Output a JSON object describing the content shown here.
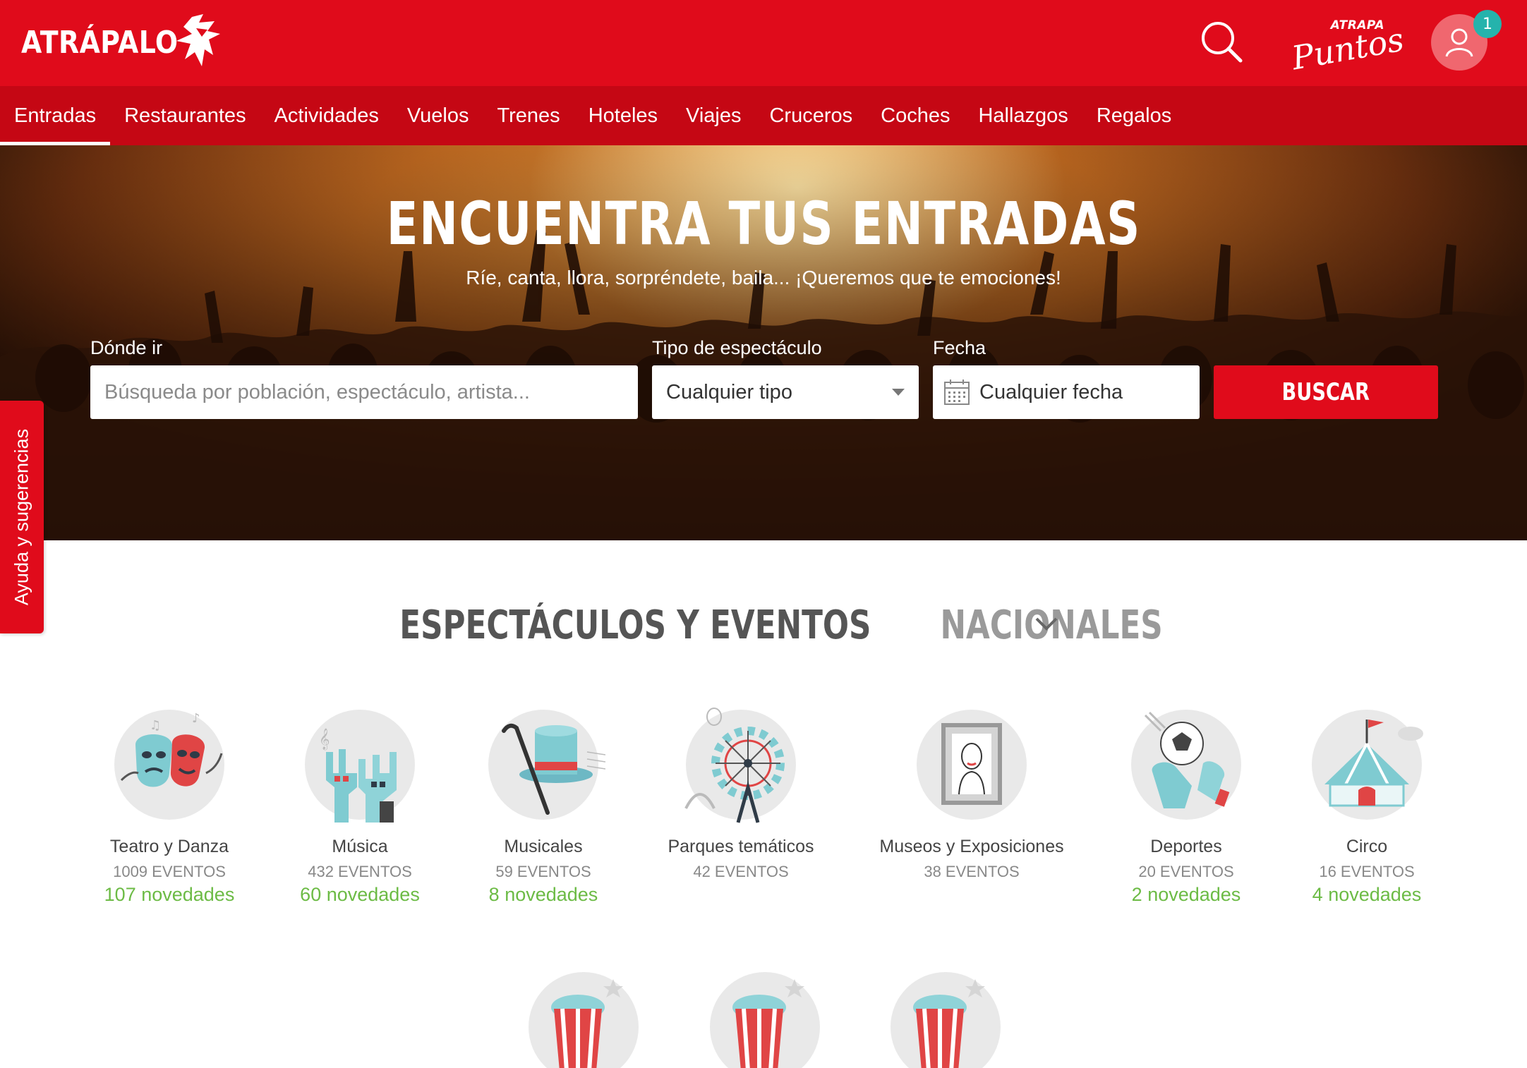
{
  "header": {
    "logo": "ATRÁPALO",
    "puntos_small": "ATRAPA",
    "puntos_big": "Puntos",
    "user_badge": "1"
  },
  "nav": {
    "items": [
      "Entradas",
      "Restaurantes",
      "Actividades",
      "Vuelos",
      "Trenes",
      "Hoteles",
      "Viajes",
      "Cruceros",
      "Coches",
      "Hallazgos",
      "Regalos"
    ],
    "active": "Entradas"
  },
  "hero": {
    "title": "ENCUENTRA TUS ENTRADAS",
    "subtitle": "Ríe, canta, llora, sorpréndete, baila... ¡Queremos que te emociones!"
  },
  "search": {
    "where_label": "Dónde ir",
    "where_placeholder": "Búsqueda por población, espectáculo, artista...",
    "type_label": "Tipo de espectáculo",
    "type_value": "Cualquier tipo",
    "date_label": "Fecha",
    "date_value": "Cualquier fecha",
    "button": "BUSCAR"
  },
  "side_tab": "Ayuda y sugerencias",
  "section": {
    "title_part1": "ESPECTÁCULOS Y EVENTOS",
    "title_part2": "NACIONALES"
  },
  "categories": [
    {
      "name": "Teatro y Danza",
      "count": "1009 EVENTOS",
      "new": "107 novedades",
      "icon": "theater-masks-icon"
    },
    {
      "name": "Música",
      "count": "432 EVENTOS",
      "new": "60 novedades",
      "icon": "rock-hands-icon"
    },
    {
      "name": "Musicales",
      "count": "59 EVENTOS",
      "new": "8 novedades",
      "icon": "top-hat-icon"
    },
    {
      "name": "Parques temáticos",
      "count": "42 EVENTOS",
      "new": "",
      "icon": "ferris-wheel-icon"
    },
    {
      "name": "Museos y Exposiciones",
      "count": "38 EVENTOS",
      "new": "",
      "icon": "framed-painting-icon"
    },
    {
      "name": "Deportes",
      "count": "20 EVENTOS",
      "new": "2 novedades",
      "icon": "soccer-goalkeeper-icon"
    },
    {
      "name": "Circo",
      "count": "16 EVENTOS",
      "new": "4 novedades",
      "icon": "circus-tent-icon"
    }
  ],
  "colors": {
    "brand_red": "#e00b1b",
    "nav_red": "#c50714",
    "green": "#6cbb45",
    "badge_teal": "#25b3ac"
  }
}
